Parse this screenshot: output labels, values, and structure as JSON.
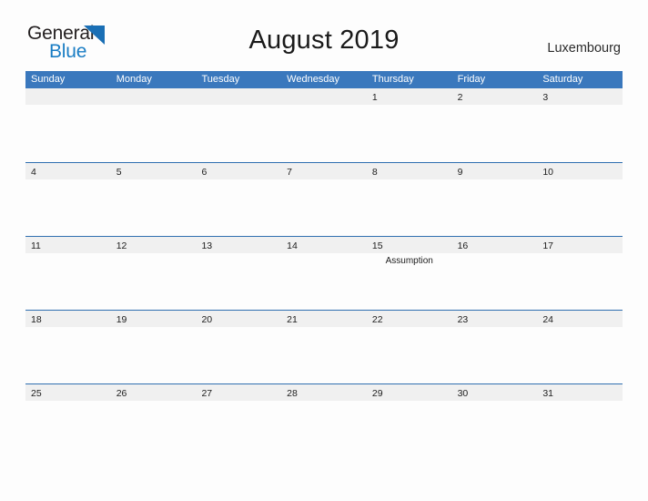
{
  "brand": {
    "name_part1": "General",
    "name_part2": "Blue",
    "triangle_color": "#1a6fb5"
  },
  "header": {
    "title": "August 2019",
    "country": "Luxembourg"
  },
  "colors": {
    "header_blue": "#3a78bd",
    "row_divider_blue": "#2f6fb0",
    "date_band_gray": "#f0f0f0",
    "page_background": "#fdfdfd",
    "text_dark": "#1c1c1c"
  },
  "calendar": {
    "weekdays": [
      "Sunday",
      "Monday",
      "Tuesday",
      "Wednesday",
      "Thursday",
      "Friday",
      "Saturday"
    ],
    "weeks": [
      [
        {
          "day": "",
          "event": ""
        },
        {
          "day": "",
          "event": ""
        },
        {
          "day": "",
          "event": ""
        },
        {
          "day": "",
          "event": ""
        },
        {
          "day": "1",
          "event": ""
        },
        {
          "day": "2",
          "event": ""
        },
        {
          "day": "3",
          "event": ""
        }
      ],
      [
        {
          "day": "4",
          "event": ""
        },
        {
          "day": "5",
          "event": ""
        },
        {
          "day": "6",
          "event": ""
        },
        {
          "day": "7",
          "event": ""
        },
        {
          "day": "8",
          "event": ""
        },
        {
          "day": "9",
          "event": ""
        },
        {
          "day": "10",
          "event": ""
        }
      ],
      [
        {
          "day": "11",
          "event": ""
        },
        {
          "day": "12",
          "event": ""
        },
        {
          "day": "13",
          "event": ""
        },
        {
          "day": "14",
          "event": ""
        },
        {
          "day": "15",
          "event": "Assumption"
        },
        {
          "day": "16",
          "event": ""
        },
        {
          "day": "17",
          "event": ""
        }
      ],
      [
        {
          "day": "18",
          "event": ""
        },
        {
          "day": "19",
          "event": ""
        },
        {
          "day": "20",
          "event": ""
        },
        {
          "day": "21",
          "event": ""
        },
        {
          "day": "22",
          "event": ""
        },
        {
          "day": "23",
          "event": ""
        },
        {
          "day": "24",
          "event": ""
        }
      ],
      [
        {
          "day": "25",
          "event": ""
        },
        {
          "day": "26",
          "event": ""
        },
        {
          "day": "27",
          "event": ""
        },
        {
          "day": "28",
          "event": ""
        },
        {
          "day": "29",
          "event": ""
        },
        {
          "day": "30",
          "event": ""
        },
        {
          "day": "31",
          "event": ""
        }
      ]
    ]
  }
}
